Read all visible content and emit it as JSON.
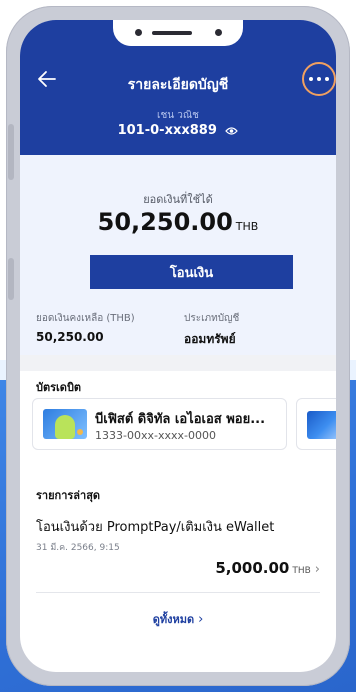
{
  "header": {
    "title": "รายละเอียดบัญชี",
    "account_name": "เชน วณิช",
    "account_number": "101-0-xxx889"
  },
  "balance": {
    "available_label": "ยอดเงินที่ใช้ได้",
    "available_amount": "50,250.00",
    "currency": "THB",
    "transfer_button": "โอนเงิน",
    "remaining_label": "ยอดเงินคงเหลือ (THB)",
    "remaining_value": "50,250.00",
    "account_type_label": "ประเภทบัญชี",
    "account_type_value": "ออมทรัพย์"
  },
  "debit_cards": {
    "section_title": "บัตรเดบิต",
    "items": [
      {
        "name": "บีเฟิสต์ ดิจิทัล เอไอเอส พอย...",
        "number": "1333-00xx-xxxx-0000"
      }
    ]
  },
  "transactions": {
    "section_title": "รายการล่าสุด",
    "items": [
      {
        "description": "โอนเงินด้วย PromptPay/เติมเงิน eWallet",
        "date": "31 มี.ค. 2566, 9:15",
        "amount": "5,000.00",
        "currency": "THB"
      }
    ],
    "see_all": "ดูทั้งหมด"
  },
  "colors": {
    "header_bg": "#1e3fa0",
    "accent_ring": "#f0a060",
    "balance_bg": "#eff3fd"
  }
}
